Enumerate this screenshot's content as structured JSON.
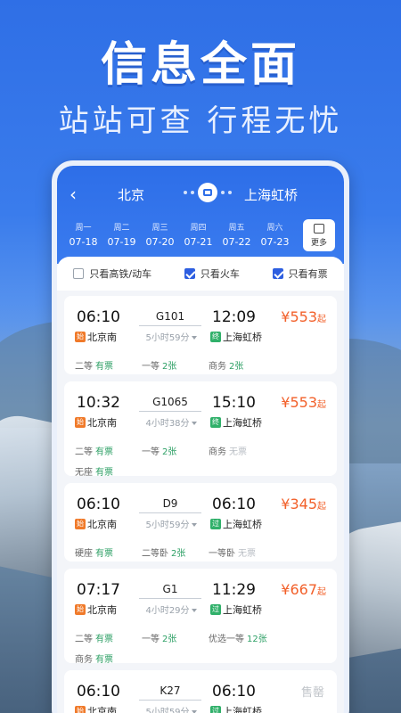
{
  "headline": "信息全面",
  "subline": "站站可查 行程无忧",
  "header": {
    "from": "北京",
    "to": "上海虹桥"
  },
  "dates": [
    {
      "wd": "周一",
      "md": "07-18"
    },
    {
      "wd": "周二",
      "md": "07-19"
    },
    {
      "wd": "周三",
      "md": "07-20"
    },
    {
      "wd": "周四",
      "md": "07-21"
    },
    {
      "wd": "周五",
      "md": "07-22"
    },
    {
      "wd": "周六",
      "md": "07-23"
    }
  ],
  "more_label": "更多",
  "filters": [
    {
      "label": "只看高铁/动车",
      "checked": false
    },
    {
      "label": "只看火车",
      "checked": true
    },
    {
      "label": "只看有票",
      "checked": true
    }
  ],
  "trains": [
    {
      "dep": "06:10",
      "train": "G101",
      "arr": "12:09",
      "duration": "5小时59分",
      "dep_st": "北京南",
      "arr_st": "上海虹桥",
      "dep_tag": "始",
      "arr_tag": "终",
      "price": "¥553",
      "price_suffix": "起",
      "seats": [
        {
          "t": "二等",
          "a": "有票"
        },
        {
          "t": "一等",
          "a": "2张"
        },
        {
          "t": "商务",
          "a": "2张"
        }
      ]
    },
    {
      "dep": "10:32",
      "train": "G1065",
      "arr": "15:10",
      "duration": "4小时38分",
      "dep_st": "北京南",
      "arr_st": "上海虹桥",
      "dep_tag": "始",
      "arr_tag": "终",
      "price": "¥553",
      "price_suffix": "起",
      "seats": [
        {
          "t": "二等",
          "a": "有票"
        },
        {
          "t": "一等",
          "a": "2张"
        },
        {
          "t": "商务",
          "a": "无票"
        },
        {
          "t": "无座",
          "a": "有票"
        }
      ]
    },
    {
      "dep": "06:10",
      "train": "D9",
      "arr": "06:10",
      "duration": "5小时59分",
      "dep_st": "北京南",
      "arr_st": "上海虹桥",
      "dep_tag": "始",
      "arr_tag": "过",
      "price": "¥345",
      "price_suffix": "起",
      "seats": [
        {
          "t": "硬座",
          "a": "有票"
        },
        {
          "t": "二等卧",
          "a": "2张"
        },
        {
          "t": "一等卧",
          "a": "无票"
        }
      ]
    },
    {
      "dep": "07:17",
      "train": "G1",
      "arr": "11:29",
      "duration": "4小时29分",
      "dep_st": "北京南",
      "arr_st": "上海虹桥",
      "dep_tag": "始",
      "arr_tag": "过",
      "price": "¥667",
      "price_suffix": "起",
      "seats": [
        {
          "t": "二等",
          "a": "有票"
        },
        {
          "t": "一等",
          "a": "2张"
        },
        {
          "t": "优选一等",
          "a": "12张"
        },
        {
          "t": "商务",
          "a": "有票"
        }
      ]
    },
    {
      "dep": "06:10",
      "train": "K27",
      "arr": "06:10",
      "duration": "5小时59分",
      "dep_st": "北京南",
      "arr_st": "上海虹桥",
      "dep_tag": "始",
      "arr_tag": "过",
      "status": "售罄",
      "seats": []
    }
  ],
  "colors": {
    "primary": "#2d6ee8",
    "price": "#f2602a",
    "available": "#2ea066",
    "unavailable": "#b9bec4"
  }
}
